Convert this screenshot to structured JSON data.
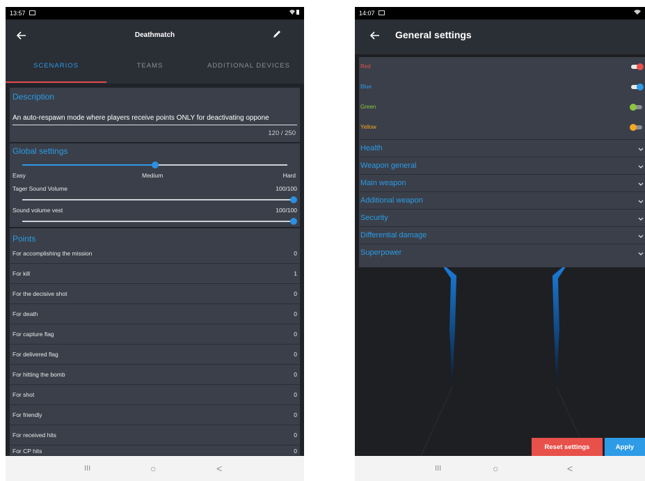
{
  "left": {
    "status": {
      "time": "13:57"
    },
    "appbar": {
      "title": "Deathmatch"
    },
    "tabs": [
      {
        "label": "SCENARIOS",
        "active": true
      },
      {
        "label": "TEAMS",
        "active": false
      },
      {
        "label": "ADDITIONAL DEVICES",
        "active": false
      }
    ],
    "description": {
      "title": "Description",
      "text": "An auto-respawn mode where players receive points ONLY for deactivating oppone",
      "counter": "120 / 250"
    },
    "global_settings": {
      "title": "Global settings",
      "difficulty": {
        "min_label": "Easy",
        "value_label": "Medium",
        "max_label": "Hard",
        "value_fraction": 0.5
      },
      "tager_sound": {
        "label": "Tager Sound Volume",
        "value": "100/100",
        "fraction": 1.0
      },
      "vest_sound": {
        "label": "Sound volume vest",
        "value": "100/100",
        "fraction": 1.0
      }
    },
    "points": {
      "title": "Points",
      "rows": [
        {
          "label": "For accomplishing the mission",
          "value": "0"
        },
        {
          "label": "For kill",
          "value": "1"
        },
        {
          "label": "For the decisive shot",
          "value": "0"
        },
        {
          "label": "For death",
          "value": "0"
        },
        {
          "label": "For capture flag",
          "value": "0"
        },
        {
          "label": "For delivered flag",
          "value": "0"
        },
        {
          "label": "For hitting the bomb",
          "value": "0"
        },
        {
          "label": "For shot",
          "value": "0"
        },
        {
          "label": "For friendly",
          "value": "0"
        },
        {
          "label": "For received hits",
          "value": "0"
        },
        {
          "label": "For CP hits",
          "value": "0"
        }
      ]
    },
    "nav": {
      "recent": "III",
      "home": "○",
      "back": "<"
    }
  },
  "right": {
    "status": {
      "time": "14:07"
    },
    "appbar": {
      "title": "General settings"
    },
    "colors": [
      {
        "label": "Red",
        "color": "#e8504a",
        "on": true
      },
      {
        "label": "Blue",
        "color": "#2d9be6",
        "on": true
      },
      {
        "label": "Green",
        "color": "#8dc63f",
        "on": false
      },
      {
        "label": "Yellow",
        "color": "#f5a623",
        "on": false
      }
    ],
    "sections": [
      {
        "label": "Health"
      },
      {
        "label": "Weapon general"
      },
      {
        "label": "Main weapon"
      },
      {
        "label": "Additional weapon"
      },
      {
        "label": "Security"
      },
      {
        "label": "Differential damage"
      },
      {
        "label": "Superpower"
      }
    ],
    "buttons": {
      "reset": "Reset settings",
      "apply": "Apply"
    },
    "nav": {
      "recent": "III",
      "home": "○",
      "back": "<"
    }
  },
  "theme": {
    "accent": "#2d9be6",
    "tab_indicator": "#e34a4a",
    "panel": "#3a3f49",
    "background": "#202329"
  }
}
